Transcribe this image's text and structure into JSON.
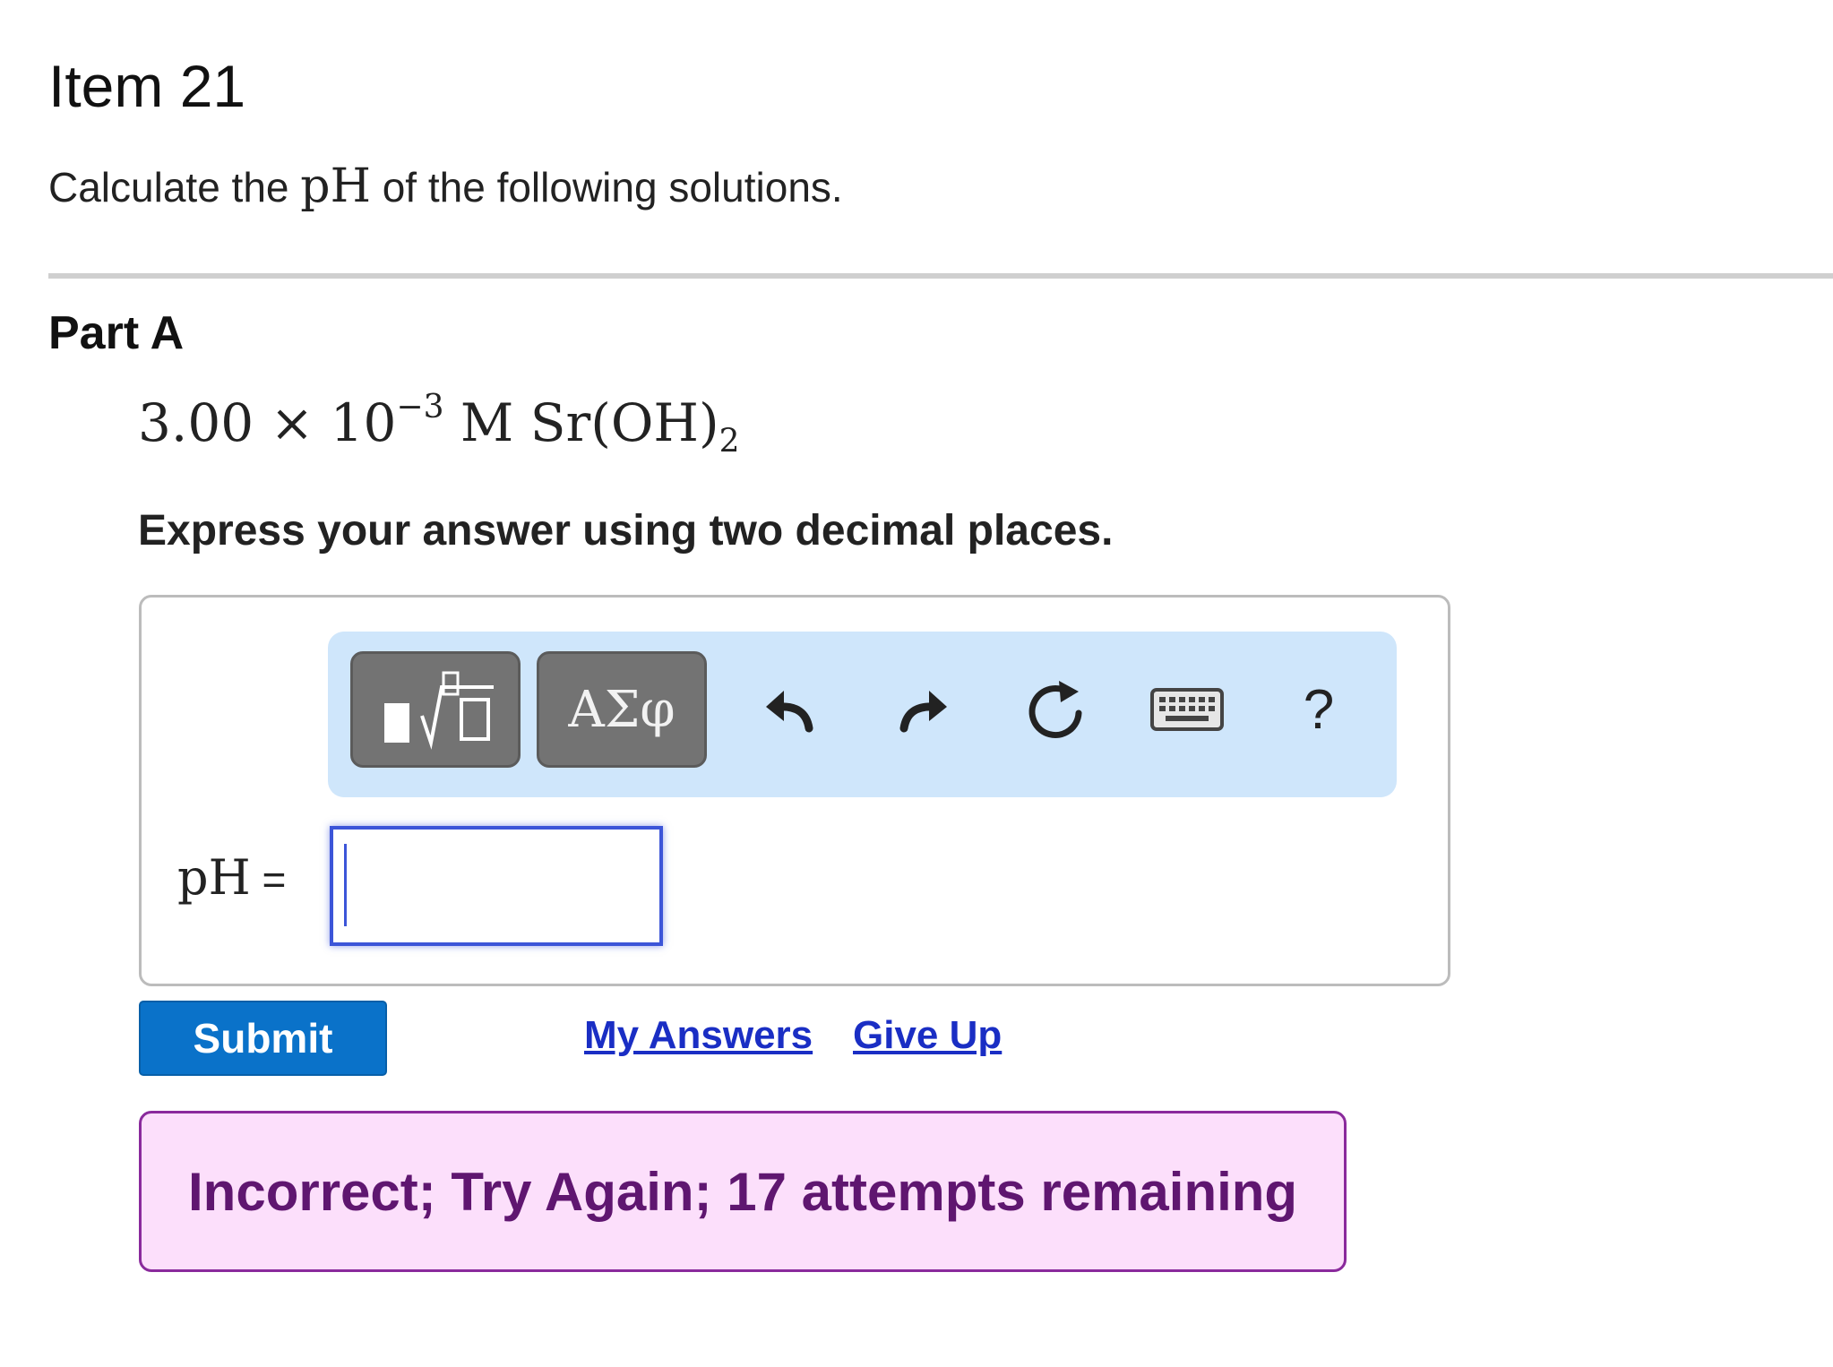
{
  "item": {
    "title": "Item 21"
  },
  "intro": {
    "prefix": "Calculate the ",
    "quantity": "pH",
    "suffix": " of the following solutions."
  },
  "part": {
    "title": "Part A",
    "problem": {
      "coefficient": "3.00 × 10",
      "exponent": "−3",
      "unit": " M Sr(OH)",
      "subscript": "2"
    },
    "instruction": "Express your answer using two decimal places."
  },
  "toolbar": {
    "template_icon": "template-root-icon",
    "greek_label": "ΑΣφ",
    "undo_icon": "undo-icon",
    "redo_icon": "redo-icon",
    "reset_icon": "reset-icon",
    "keyboard_icon": "keyboard-icon",
    "help_label": "?"
  },
  "answer": {
    "label": "pH",
    "equals": " =",
    "value": ""
  },
  "actions": {
    "submit_label": "Submit",
    "my_answers_label": "My Answers",
    "give_up_label": "Give Up"
  },
  "feedback": {
    "message": "Incorrect; Try Again; 17 attempts remaining"
  },
  "colors": {
    "submit": "#0a72c9",
    "link": "#1a2ec4",
    "toolbar_bg": "#cfe6fb",
    "feedback_bg": "#fcdffb",
    "feedback_border": "#8a2a9c",
    "input_focus": "#3c55d8"
  }
}
